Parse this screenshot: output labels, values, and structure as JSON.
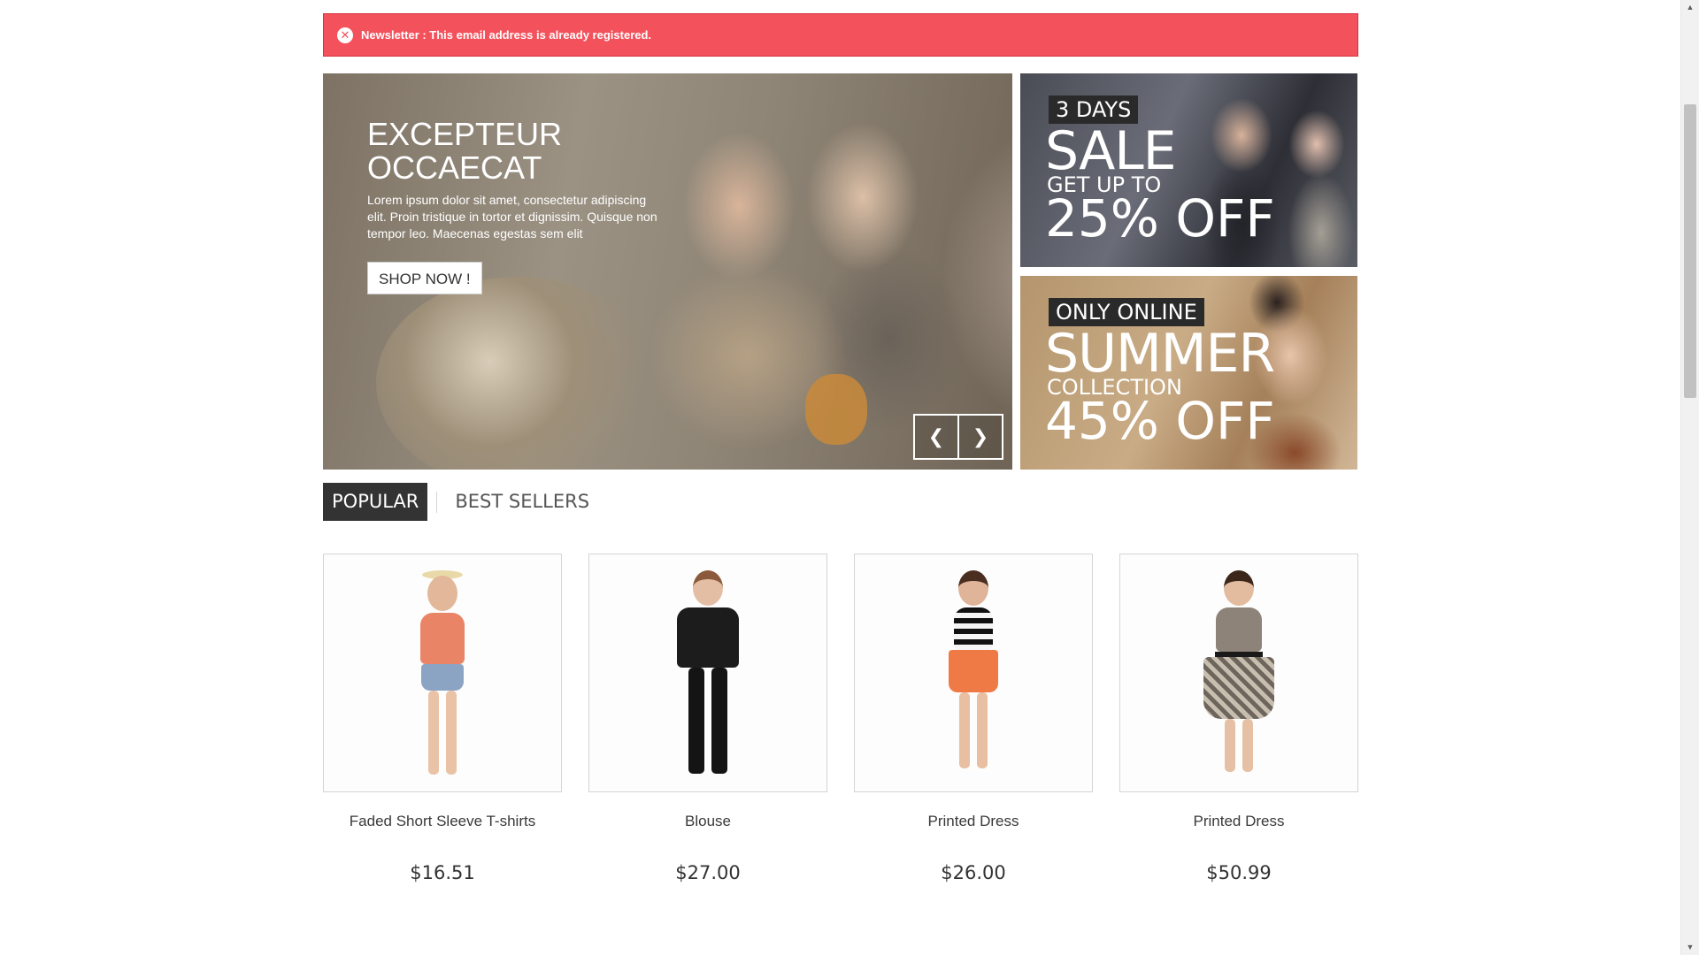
{
  "alert": {
    "text": "Newsletter : This email address is already registered.",
    "icon": "close-circle-icon",
    "color": "#f3515c"
  },
  "slider": {
    "title": "EXCEPTEUR OCCAECAT",
    "text": "Lorem ipsum dolor sit amet, consectetur adipiscing elit. Proin tristique in tortor et dignissim. Quisque non tempor leo. Maecenas egestas sem elit",
    "button": "SHOP NOW !",
    "prev_icon": "chevron-left-icon",
    "next_icon": "chevron-right-icon",
    "prev_glyph": "❮",
    "next_glyph": "❯"
  },
  "promos": [
    {
      "tag": "3 DAYS",
      "big": "SALE",
      "small": "GET UP TO",
      "off": "25% OFF"
    },
    {
      "tag": "ONLY ONLINE",
      "big": "SUMMER",
      "small": "COLLECTION",
      "off": "45% OFF"
    }
  ],
  "tabs": [
    {
      "label": "POPULAR",
      "active": true
    },
    {
      "label": "BEST SELLERS",
      "active": false
    }
  ],
  "products": [
    {
      "name": "Faded Short Sleeve T-shirts",
      "price": "$16.51"
    },
    {
      "name": "Blouse",
      "price": "$27.00"
    },
    {
      "name": "Printed Dress",
      "price": "$26.00"
    },
    {
      "name": "Printed Dress",
      "price": "$50.99"
    }
  ],
  "scrollbar": {
    "up_glyph": "▲",
    "down_glyph": "▼"
  }
}
